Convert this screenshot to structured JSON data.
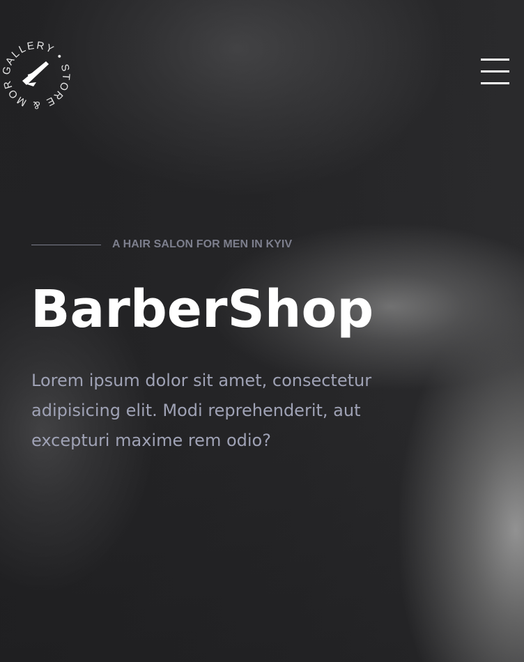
{
  "logo": {
    "ring_text": "GALLERY • STORE & MORE •",
    "icon": "razor-icon"
  },
  "header": {
    "menu_icon": "hamburger-menu-icon"
  },
  "hero": {
    "tagline": "A HAIR SALON FOR MEN IN KYIV",
    "title": "BarberShop",
    "description": "Lorem ipsum dolor sit amet, consectetur adipisicing elit. Modi reprehenderit, aut excepturi maxime rem odio?"
  },
  "colors": {
    "title": "#ffffff",
    "tagline": "#7d7f8d",
    "description": "#9fa2b5",
    "background": "#2a2a2c"
  }
}
